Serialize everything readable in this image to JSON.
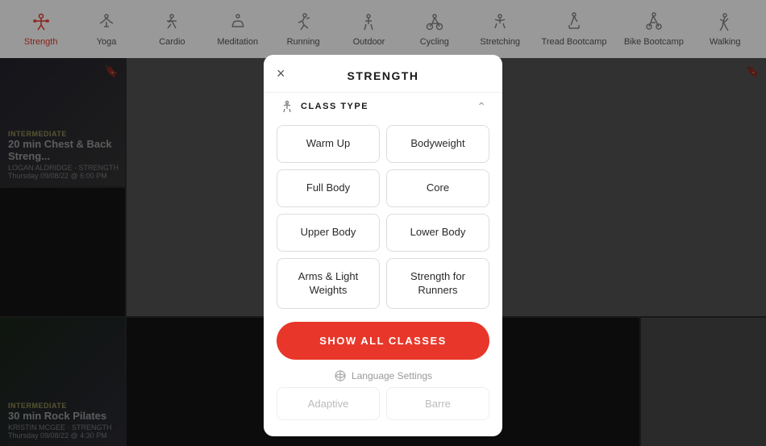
{
  "nav": {
    "items": [
      {
        "id": "strength",
        "label": "Strength",
        "active": true
      },
      {
        "id": "yoga",
        "label": "Yoga",
        "active": false
      },
      {
        "id": "cardio",
        "label": "Cardio",
        "active": false
      },
      {
        "id": "meditation",
        "label": "Meditation",
        "active": false
      },
      {
        "id": "running",
        "label": "Running",
        "active": false
      },
      {
        "id": "outdoor",
        "label": "Outdoor",
        "active": false
      },
      {
        "id": "cycling",
        "label": "Cycling",
        "active": false
      },
      {
        "id": "stretching",
        "label": "Stretching",
        "active": false
      },
      {
        "id": "tread-bootcamp",
        "label": "Tread Bootcamp",
        "active": false
      },
      {
        "id": "bike-bootcamp",
        "label": "Bike Bootcamp",
        "active": false
      },
      {
        "id": "walking",
        "label": "Walking",
        "active": false
      }
    ]
  },
  "bg_cards": [
    {
      "badge": "INTERMEDIATE",
      "title": "20 min Chest & Back Streng...",
      "instructor": "LOGAN ALDRIDGE · STRENGTH",
      "date": "Thursday 09/08/22 @ 6:00 PM"
    },
    {
      "badge": "",
      "title": "",
      "instructor": "",
      "date": ""
    },
    {
      "badge": "INTERMEDIATE",
      "title": "30 min Rock Pilates",
      "instructor": "KRISTIN MCGEE · STRENGTH",
      "date": "Thursday 09/08/22 @ 4:30 PM"
    },
    {
      "badge": "",
      "title": "",
      "instructor": "",
      "date": ""
    }
  ],
  "modal": {
    "title": "STRENGTH",
    "close_label": "×",
    "section_label": "CLASS TYPE",
    "class_types": [
      {
        "id": "warm-up",
        "label": "Warm Up"
      },
      {
        "id": "bodyweight",
        "label": "Bodyweight"
      },
      {
        "id": "full-body",
        "label": "Full Body"
      },
      {
        "id": "core",
        "label": "Core"
      },
      {
        "id": "upper-body",
        "label": "Upper Body"
      },
      {
        "id": "lower-body",
        "label": "Lower Body"
      },
      {
        "id": "arms-light",
        "label": "Arms & Light Weights"
      },
      {
        "id": "strength-runners",
        "label": "Strength for Runners"
      }
    ],
    "show_all_label": "SHOW ALL CLASSES",
    "language_label": "Language Settings",
    "faded_options": [
      {
        "label": "Adaptive"
      },
      {
        "label": "Barre"
      }
    ]
  },
  "colors": {
    "accent": "#e8372a",
    "active_nav": "#e8372a"
  }
}
